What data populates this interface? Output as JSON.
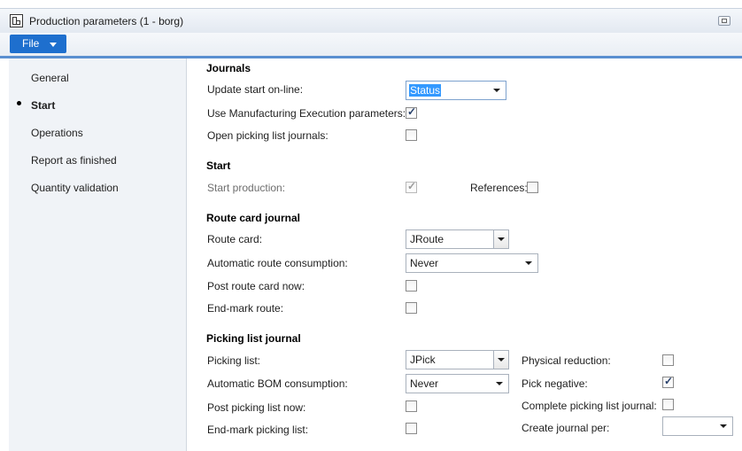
{
  "window": {
    "title": "Production parameters (1 - borg)"
  },
  "menu": {
    "file_label": "File"
  },
  "nav": {
    "items": [
      {
        "label": "General",
        "active": false
      },
      {
        "label": "Start",
        "active": true
      },
      {
        "label": "Operations",
        "active": false
      },
      {
        "label": "Report as finished",
        "active": false
      },
      {
        "label": "Quantity validation",
        "active": false
      }
    ]
  },
  "journals": {
    "title": "Journals",
    "update_start_online_label": "Update start on-line:",
    "update_start_online_value": "Status",
    "use_mes_params_label": "Use Manufacturing Execution parameters:",
    "use_mes_params_checked": true,
    "open_picking_list_journals_label": "Open picking list journals:",
    "open_picking_list_journals_checked": false
  },
  "start": {
    "title": "Start",
    "start_production_label": "Start production:",
    "start_production_checked": true,
    "references_label": "References:",
    "references_checked": false
  },
  "route_card": {
    "title": "Route card journal",
    "route_card_label": "Route card:",
    "route_card_value": "JRoute",
    "auto_route_consumption_label": "Automatic route consumption:",
    "auto_route_consumption_value": "Never",
    "post_route_card_now_label": "Post route card now:",
    "post_route_card_now_checked": false,
    "end_mark_route_label": "End-mark route:",
    "end_mark_route_checked": false
  },
  "picking_list": {
    "title": "Picking list journal",
    "picking_list_label": "Picking list:",
    "picking_list_value": "JPick",
    "auto_bom_consumption_label": "Automatic BOM consumption:",
    "auto_bom_consumption_value": "Never",
    "post_picking_list_now_label": "Post picking list now:",
    "post_picking_list_now_checked": false,
    "end_mark_picking_list_label": "End-mark picking list:",
    "end_mark_picking_list_checked": false,
    "physical_reduction_label": "Physical reduction:",
    "physical_reduction_checked": false,
    "pick_negative_label": "Pick negative:",
    "pick_negative_checked": true,
    "complete_picking_list_journal_label": "Complete picking list journal:",
    "complete_picking_list_journal_checked": false,
    "create_journal_per_label": "Create journal per:",
    "create_journal_per_value": ""
  }
}
